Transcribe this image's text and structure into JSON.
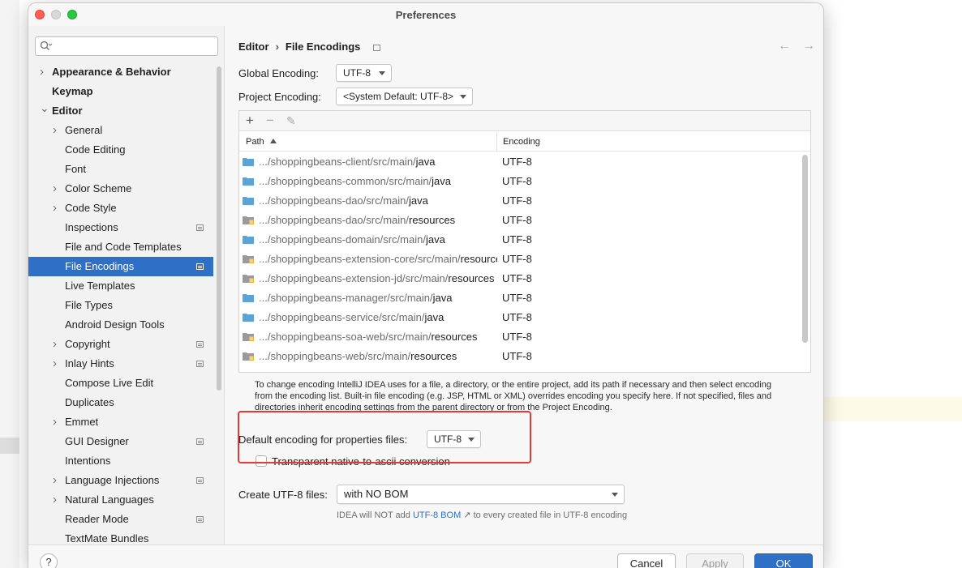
{
  "window": {
    "title": "Preferences"
  },
  "sidebar": {
    "search_placeholder": "",
    "items": [
      {
        "label": "Appearance & Behavior",
        "level": 0,
        "expander": "collapsed",
        "bold": true,
        "marker": false
      },
      {
        "label": "Keymap",
        "level": 0,
        "expander": "none",
        "bold": true,
        "marker": false
      },
      {
        "label": "Editor",
        "level": 0,
        "expander": "expanded",
        "bold": true,
        "marker": false
      },
      {
        "label": "General",
        "level": 1,
        "expander": "collapsed",
        "bold": false,
        "marker": false
      },
      {
        "label": "Code Editing",
        "level": 1,
        "expander": "none",
        "bold": false,
        "marker": false
      },
      {
        "label": "Font",
        "level": 1,
        "expander": "none",
        "bold": false,
        "marker": false
      },
      {
        "label": "Color Scheme",
        "level": 1,
        "expander": "collapsed",
        "bold": false,
        "marker": false
      },
      {
        "label": "Code Style",
        "level": 1,
        "expander": "collapsed",
        "bold": false,
        "marker": false
      },
      {
        "label": "Inspections",
        "level": 1,
        "expander": "none",
        "bold": false,
        "marker": true
      },
      {
        "label": "File and Code Templates",
        "level": 1,
        "expander": "none",
        "bold": false,
        "marker": false
      },
      {
        "label": "File Encodings",
        "level": 1,
        "expander": "none",
        "bold": false,
        "marker": true,
        "selected": true
      },
      {
        "label": "Live Templates",
        "level": 1,
        "expander": "none",
        "bold": false,
        "marker": false
      },
      {
        "label": "File Types",
        "level": 1,
        "expander": "none",
        "bold": false,
        "marker": false
      },
      {
        "label": "Android Design Tools",
        "level": 1,
        "expander": "none",
        "bold": false,
        "marker": false
      },
      {
        "label": "Copyright",
        "level": 1,
        "expander": "collapsed",
        "bold": false,
        "marker": true
      },
      {
        "label": "Inlay Hints",
        "level": 1,
        "expander": "collapsed",
        "bold": false,
        "marker": true
      },
      {
        "label": "Compose Live Edit",
        "level": 1,
        "expander": "none",
        "bold": false,
        "marker": false
      },
      {
        "label": "Duplicates",
        "level": 1,
        "expander": "none",
        "bold": false,
        "marker": false
      },
      {
        "label": "Emmet",
        "level": 1,
        "expander": "collapsed",
        "bold": false,
        "marker": false
      },
      {
        "label": "GUI Designer",
        "level": 1,
        "expander": "none",
        "bold": false,
        "marker": true
      },
      {
        "label": "Intentions",
        "level": 1,
        "expander": "none",
        "bold": false,
        "marker": false
      },
      {
        "label": "Language Injections",
        "level": 1,
        "expander": "collapsed",
        "bold": false,
        "marker": true
      },
      {
        "label": "Natural Languages",
        "level": 1,
        "expander": "collapsed",
        "bold": false,
        "marker": false
      },
      {
        "label": "Reader Mode",
        "level": 1,
        "expander": "none",
        "bold": false,
        "marker": true
      },
      {
        "label": "TextMate Bundles",
        "level": 1,
        "expander": "none",
        "bold": false,
        "marker": false
      }
    ]
  },
  "breadcrumb": {
    "parent": "Editor",
    "separator": "›",
    "current": "File Encodings"
  },
  "nav": {
    "back": "←",
    "forward": "→"
  },
  "global_encoding": {
    "label": "Global Encoding:",
    "value": "UTF-8"
  },
  "project_encoding": {
    "label": "Project Encoding:",
    "value": "<System Default: UTF-8>"
  },
  "table": {
    "toolbar": {
      "add": "+",
      "remove": "−",
      "edit": "✎"
    },
    "columns": {
      "path": "Path",
      "encoding": "Encoding"
    },
    "rows": [
      {
        "prefix": ".../shoppingbeans-client/src/main/",
        "tail": "java",
        "encoding": "UTF-8",
        "icon": "source-folder-icon"
      },
      {
        "prefix": ".../shoppingbeans-common/src/main/",
        "tail": "java",
        "encoding": "UTF-8",
        "icon": "source-folder-icon"
      },
      {
        "prefix": ".../shoppingbeans-dao/src/main/",
        "tail": "java",
        "encoding": "UTF-8",
        "icon": "source-folder-icon"
      },
      {
        "prefix": ".../shoppingbeans-dao/src/main/",
        "tail": "resources",
        "encoding": "UTF-8",
        "icon": "resources-folder-icon"
      },
      {
        "prefix": ".../shoppingbeans-domain/src/main/",
        "tail": "java",
        "encoding": "UTF-8",
        "icon": "source-folder-icon"
      },
      {
        "prefix": ".../shoppingbeans-extension-core/src/main/",
        "tail": "resources",
        "encoding": "UTF-8",
        "icon": "resources-folder-icon"
      },
      {
        "prefix": ".../shoppingbeans-extension-jd/src/main/",
        "tail": "resources",
        "encoding": "UTF-8",
        "icon": "resources-folder-icon"
      },
      {
        "prefix": ".../shoppingbeans-manager/src/main/",
        "tail": "java",
        "encoding": "UTF-8",
        "icon": "source-folder-icon"
      },
      {
        "prefix": ".../shoppingbeans-service/src/main/",
        "tail": "java",
        "encoding": "UTF-8",
        "icon": "source-folder-icon"
      },
      {
        "prefix": ".../shoppingbeans-soa-web/src/main/",
        "tail": "resources",
        "encoding": "UTF-8",
        "icon": "resources-folder-icon"
      },
      {
        "prefix": ".../shoppingbeans-web/src/main/",
        "tail": "resources",
        "encoding": "UTF-8",
        "icon": "resources-folder-icon"
      }
    ]
  },
  "help_text": "To change encoding IntelliJ IDEA uses for a file, a directory, or the entire project, add its path if necessary and then select encoding from the encoding list. Built-in file encoding (e.g. JSP, HTML or XML) overrides encoding you specify here. If not specified, files and directories inherit encoding settings from the parent directory or from the Project Encoding.",
  "properties_encoding": {
    "label": "Default encoding for properties files:",
    "value": "UTF-8"
  },
  "native_to_ascii": {
    "label": "Transparent native-to-ascii conversion",
    "checked": false
  },
  "create_utf8": {
    "label": "Create UTF-8 files:",
    "value": "with NO BOM"
  },
  "bom_info": {
    "prefix": "IDEA will NOT add",
    "link": "UTF-8 BOM",
    "link_arrow": "↗",
    "suffix": "to every created file in UTF-8 encoding"
  },
  "footer": {
    "help": "?",
    "cancel": "Cancel",
    "apply": "Apply",
    "ok": "OK"
  },
  "colors": {
    "accent": "#2f6fc5",
    "highlight_box": "#e53935",
    "source_folder": "#5ba4d6"
  }
}
